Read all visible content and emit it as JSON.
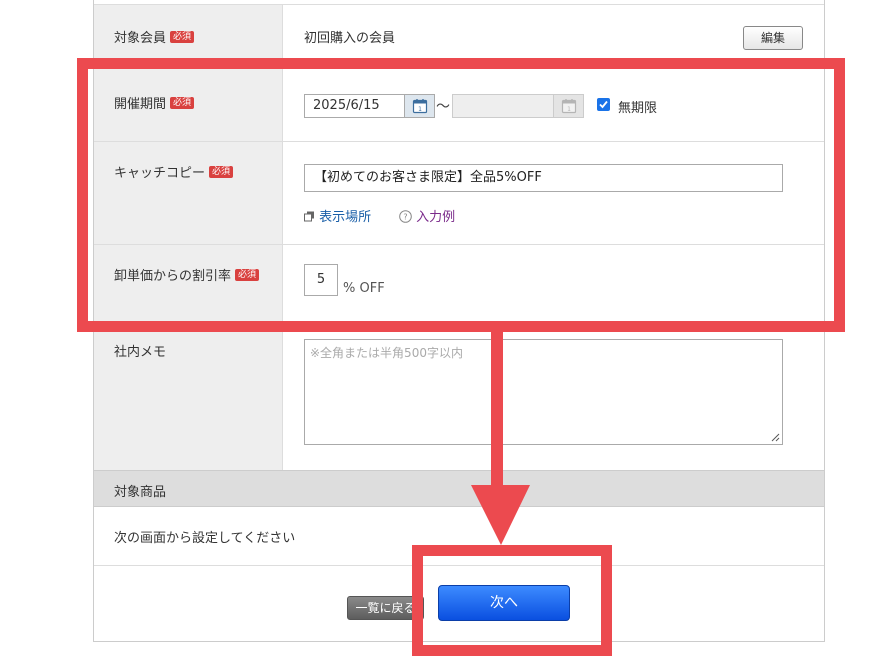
{
  "required_badge": "必須",
  "colors": {
    "highlight": "#ec4a4f",
    "primary_button": "#1a5ff0",
    "link": "#1a5fa8"
  },
  "target_members": {
    "label": "対象会員",
    "value": "初回購入の会員",
    "edit_label": "編集"
  },
  "period": {
    "label": "開催期間",
    "start_date": "2025/6/15",
    "end_date": "",
    "separator": "～",
    "unlimited_label": "無期限",
    "unlimited_checked": true
  },
  "catchcopy": {
    "label": "キャッチコピー",
    "value": "【初めてのお客さま限定】全品5%OFF",
    "display_location_link": "表示場所",
    "example_link": "入力例"
  },
  "discount": {
    "label": "卸単価からの割引率",
    "value": "5",
    "unit": "% OFF"
  },
  "memo": {
    "label": "社内メモ",
    "placeholder": "※全角または半角500字以内"
  },
  "products": {
    "header": "対象商品",
    "note": "次の画面から設定してください"
  },
  "footer": {
    "back_label": "一覧に戻る",
    "next_label": "次へ"
  }
}
